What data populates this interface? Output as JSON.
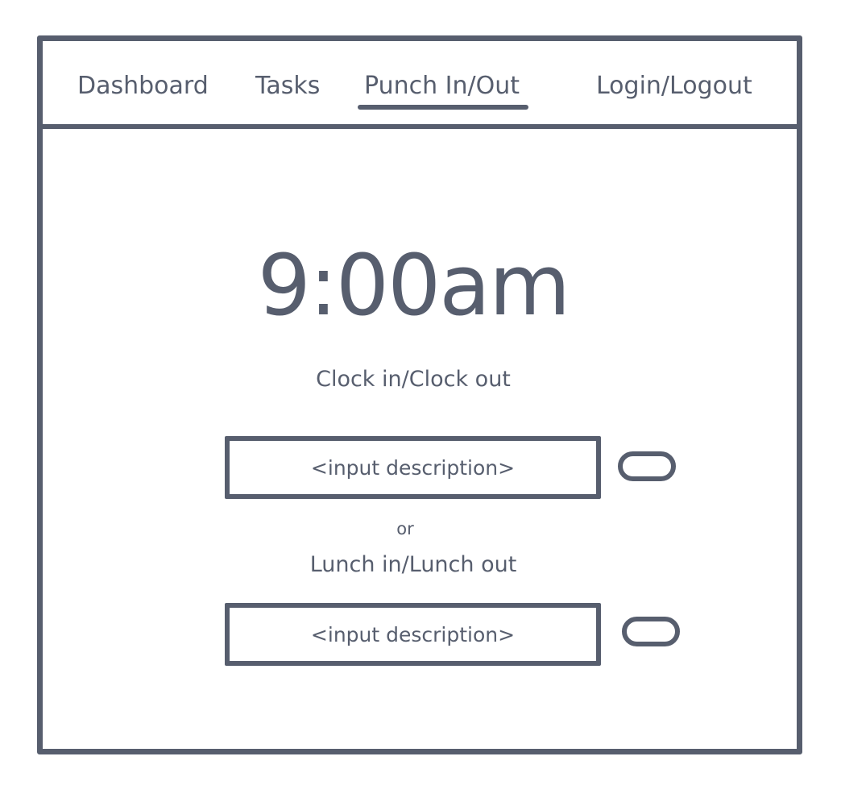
{
  "nav": {
    "items": [
      {
        "label": "Dashboard",
        "active": false
      },
      {
        "label": "Tasks",
        "active": false
      },
      {
        "label": "Punch In/Out",
        "active": true
      },
      {
        "label": "Login/Logout",
        "active": false
      }
    ]
  },
  "main": {
    "time": "9:00am",
    "clock_label": "Clock in/Clock out",
    "clock_input": {
      "value": "",
      "placeholder": "<input description>"
    },
    "or_text": "or",
    "lunch_label": "Lunch in/Lunch out",
    "lunch_input": {
      "value": "",
      "placeholder": "<input description>"
    }
  },
  "colors": {
    "stroke": "#575e6e",
    "background": "#ffffff"
  }
}
